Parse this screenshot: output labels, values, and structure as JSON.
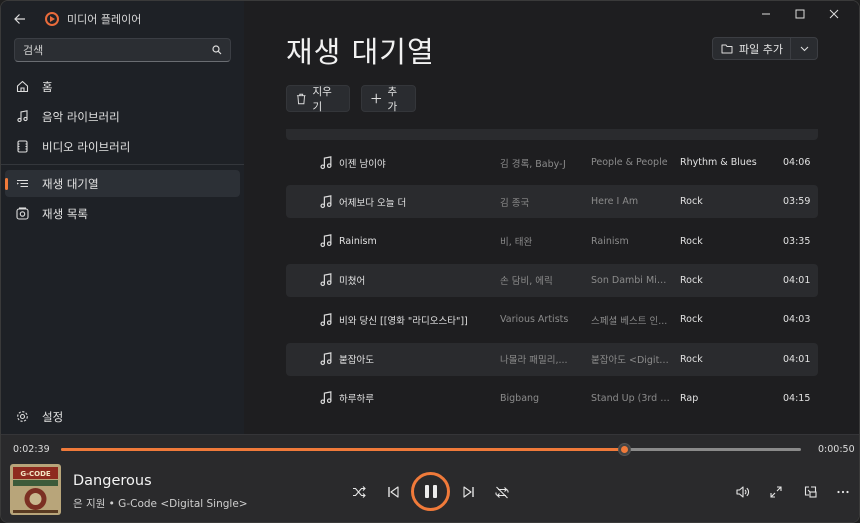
{
  "app": {
    "title": "미디어 플레이어"
  },
  "search": {
    "placeholder": "검색"
  },
  "nav": {
    "home": "홈",
    "music_library": "음악 라이브러리",
    "video_library": "비디오 라이브러리",
    "queue": "재생 대기열",
    "playlists": "재생 목록",
    "settings": "설정"
  },
  "main": {
    "title": "재생 대기열",
    "add_file_label": "파일 추가",
    "clear_label": "지우기",
    "add_label": "추가"
  },
  "queue": [
    {
      "title": "이젠 남이야",
      "artist": "김 경록, Baby-J",
      "album": "People & People",
      "genre": "Rhythm & Blues",
      "duration": "04:06"
    },
    {
      "title": "어제보다 오늘 더",
      "artist": "김 종국",
      "album": "Here I Am",
      "genre": "Rock",
      "duration": "03:59"
    },
    {
      "title": "Rainism",
      "artist": "비, 태완",
      "album": "Rainism",
      "genre": "Rock",
      "duration": "03:35"
    },
    {
      "title": "미쳤어",
      "artist": "손 담비, 에릭",
      "album": "Son Dambi Mini...",
      "genre": "Rock",
      "duration": "04:01"
    },
    {
      "title": "비와 당신 [[영화 \"라디오스타\"]]",
      "artist": "Various Artists",
      "album": "스페셜 베스트 인...",
      "genre": "Rock",
      "duration": "04:03"
    },
    {
      "title": "붙잡아도",
      "artist": "나몰라 패밀리,...",
      "album": "붙잡아도 <Digita...",
      "genre": "Rock",
      "duration": "04:01"
    },
    {
      "title": "하루하루",
      "artist": "Bigbang",
      "album": "Stand Up (3rd M...",
      "genre": "Rap",
      "duration": "04:15"
    }
  ],
  "player": {
    "elapsed": "0:02:39",
    "remaining": "0:00:50",
    "progress_fraction": 0.761,
    "song_title": "Dangerous",
    "song_subtitle": "은 지원 • G-Code <Digital Single>",
    "cover_text": "G-CODE"
  },
  "colors": {
    "accent": "#f07a3a"
  }
}
